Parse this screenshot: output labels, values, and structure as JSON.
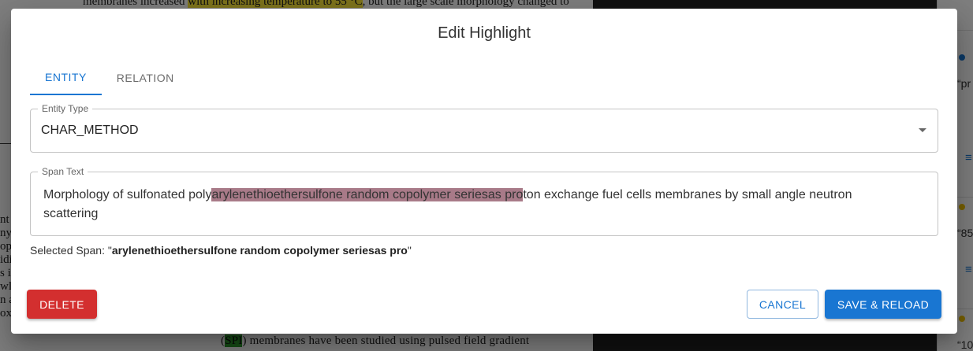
{
  "background": {
    "top_line_before": "membranes increased ",
    "top_line_highlight": "with increasing temperature to 55 °C",
    "top_line_after": ", but the large scale morphology changed to",
    "bottom_line_open": "(",
    "bottom_line_highlight": "SPI",
    "bottom_line_rest": ") membranes have been studied using pulsed field gradient",
    "left_fragments": [
      "nt",
      "ny",
      "op",
      "idi",
      "s i",
      "wl",
      "n a",
      "ox"
    ],
    "side_texts": [
      "“pr",
      "“85",
      "“10"
    ],
    "side_menu_glyph": "≡"
  },
  "dialog": {
    "title": "Edit Highlight",
    "tabs": [
      {
        "label": "ENTITY",
        "active": true
      },
      {
        "label": "RELATION",
        "active": false
      }
    ],
    "entity_type": {
      "label": "Entity Type",
      "value": "CHAR_METHOD"
    },
    "span_text": {
      "label": "Span Text",
      "before": "Morphology of sulfonated poly",
      "highlighted": "arylenethioethersulfone random copolymer seriesas pro",
      "after": "ton exchange fuel cells membranes by small angle neutron scattering"
    },
    "selected_span": {
      "prefix": "Selected Span: \"",
      "value": "arylenethioethersulfone random copolymer seriesas pro",
      "suffix": "\""
    },
    "buttons": {
      "delete": "DELETE",
      "cancel": "CANCEL",
      "save": "SAVE & RELOAD"
    }
  },
  "colors": {
    "primary": "#1976d2",
    "danger": "#d32f2f",
    "span_highlight": "#a87a88",
    "doc_highlight_yellow": "#ffeb3b",
    "doc_highlight_green": "#2e9b2e",
    "side_dot_blue": "#1976d2",
    "side_dot_yellow": "#f2c200"
  }
}
